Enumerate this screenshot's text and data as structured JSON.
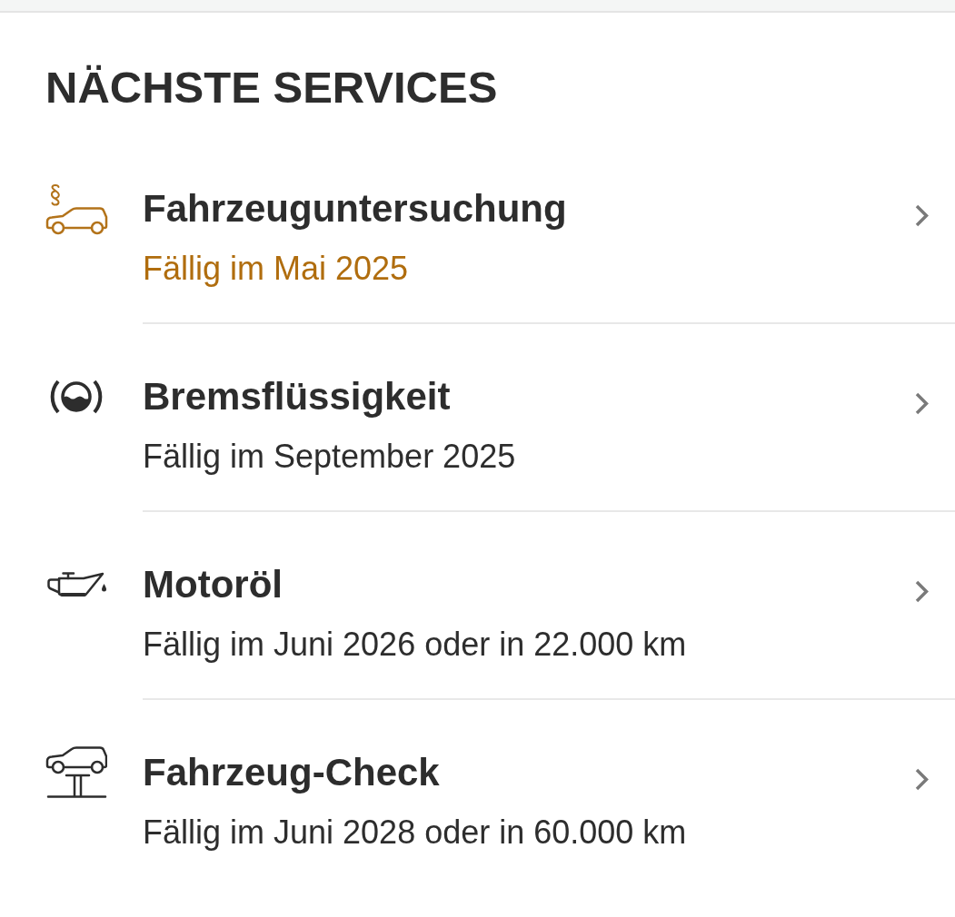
{
  "heading": "NÄCHSTE SERVICES",
  "services": [
    {
      "title": "Fahrzeuguntersuchung",
      "due": "Fällig im Mai 2025",
      "due_soon": true
    },
    {
      "title": "Bremsflüssigkeit",
      "due": "Fällig im September 2025",
      "due_soon": false
    },
    {
      "title": "Motoröl",
      "due": "Fällig im Juni 2026 oder in 22.000 km",
      "due_soon": false
    },
    {
      "title": "Fahrzeug-Check",
      "due": "Fällig im Juni 2028 oder in 60.000 km",
      "due_soon": false
    }
  ]
}
